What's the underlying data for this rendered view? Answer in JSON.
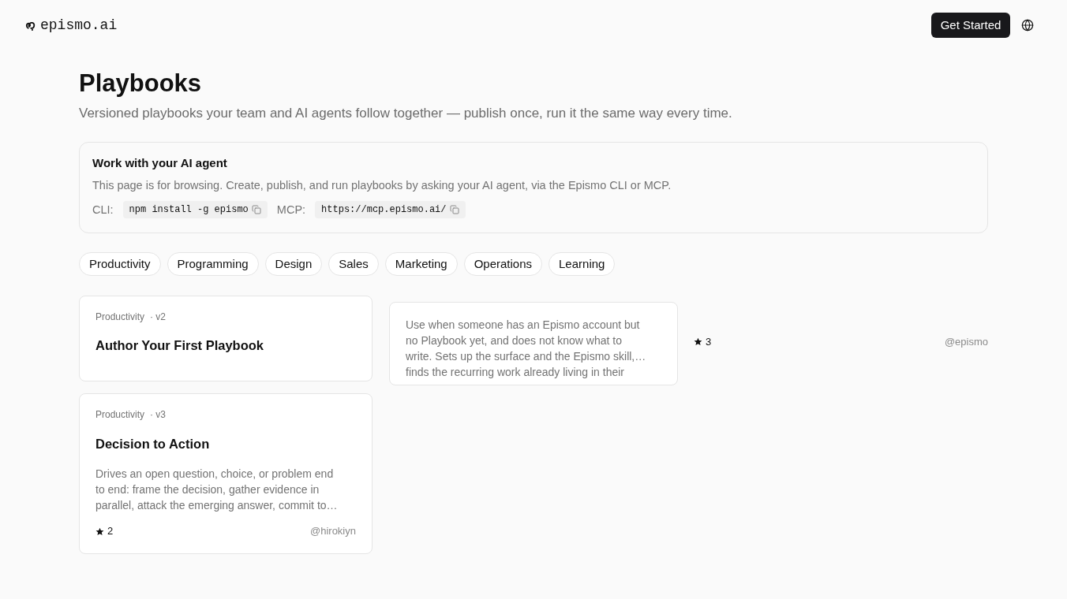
{
  "header": {
    "logo": "epismo.ai",
    "button": "Get Started"
  },
  "page": {
    "title": "Playbooks",
    "subtitle": "Versioned playbooks your team and AI agents follow together — publish once, run it the same way every time."
  },
  "agent_panel": {
    "title": "Work with your AI agent",
    "description": "This page is for browsing. Create, publish, and run playbooks by asking your AI agent, via the Epismo CLI or MCP.",
    "commands": [
      {
        "label": "CLI:",
        "code": "npm install -g epismo"
      },
      {
        "label": "MCP:",
        "code": "https://mcp.epismo.ai/"
      }
    ]
  },
  "categories": [
    {
      "label": "Productivity",
      "selected": false
    },
    {
      "label": "Programming",
      "selected": false
    },
    {
      "label": "Design",
      "selected": false
    },
    {
      "label": "Sales",
      "selected": false
    },
    {
      "label": "Marketing",
      "selected": false
    },
    {
      "label": "Operations",
      "selected": false
    },
    {
      "label": "Learning",
      "selected": false
    }
  ],
  "playbooks": [
    {
      "kind": "split",
      "category": "Productivity",
      "version": "· v2",
      "title": "Author Your First Playbook",
      "description": "Use when someone has an Epismo account but no Playbook yet, and does not know what to write. Sets up the surface and the Epismo skill,… finds the recurring work already living in their",
      "star_count": "3",
      "author": "@epismo"
    },
    {
      "kind": "card",
      "category": "Productivity",
      "version": "· v3",
      "title": "Decision to Action",
      "description": "Drives an open question, choice, or problem end to end: frame the decision, gather evidence in parallel, attack the emerging answer, commit to…",
      "star_count": "2",
      "author": "@hirokiyn"
    }
  ]
}
